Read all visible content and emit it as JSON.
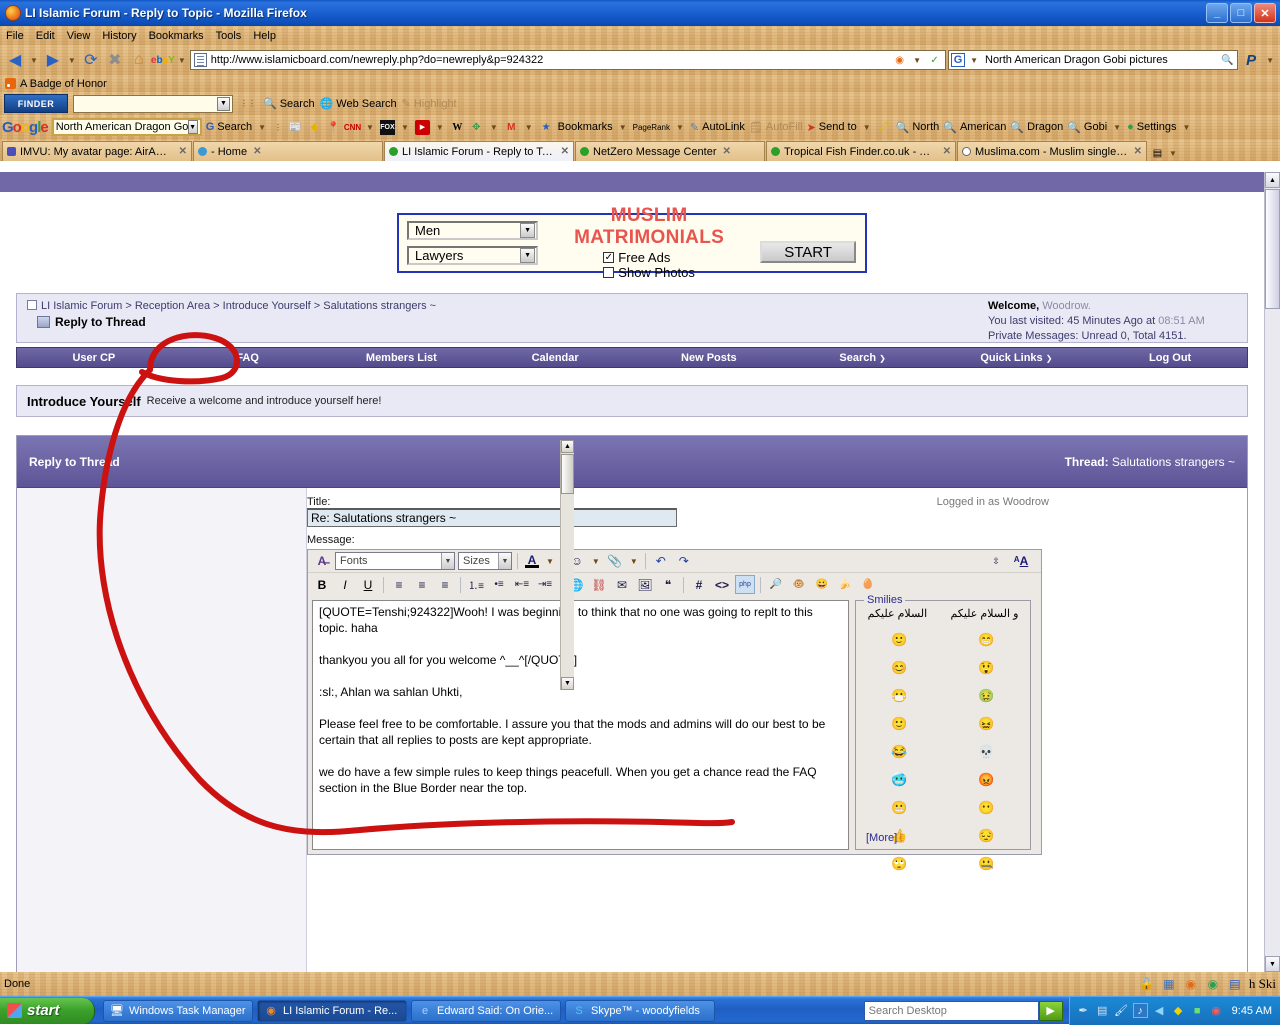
{
  "window": {
    "title": "LI Islamic Forum - Reply to Topic - Mozilla Firefox",
    "minimize": "_",
    "maximize": "□",
    "close": "✕"
  },
  "menubar": [
    "File",
    "Edit",
    "View",
    "History",
    "Bookmarks",
    "Tools",
    "Help"
  ],
  "navbar": {
    "back_icon": "back-arrow-icon",
    "forward_icon": "forward-arrow-icon",
    "reload_icon": "reload-icon",
    "stop_icon": "stop-icon",
    "home_icon": "home-icon",
    "ebay_icon": "ebay-icon",
    "url": "http://www.islamicboard.com/newreply.php?do=newreply&p=924322",
    "search_value": "North American Dragon Gobi pictures",
    "search_engine": "G",
    "paypal_icon": "paypal-icon"
  },
  "badge_bar": {
    "label": "A Badge of Honor"
  },
  "finder_bar": {
    "logo": "FINDER",
    "input_value": "",
    "buttons": [
      "Search",
      "Web Search",
      "Highlight"
    ]
  },
  "google_bar": {
    "logo_letters": [
      "G",
      "o",
      "o",
      "g",
      "l",
      "e"
    ],
    "query": "North American Dragon Gobi picture",
    "search_label": "Search",
    "items": [
      "Bookmarks",
      "PageRank",
      "AutoLink",
      "AutoFill",
      "Send to"
    ],
    "highlight_terms": [
      "North",
      "American",
      "Dragon",
      "Gobi"
    ],
    "settings_label": "Settings"
  },
  "tabs": [
    {
      "label": "IMVU: My avatar page: AirAnge...",
      "active": false,
      "icon": "imvu-icon"
    },
    {
      "label": "- Home",
      "active": false,
      "icon": "chat-icon"
    },
    {
      "label": "LI Islamic Forum - Reply to Topic",
      "active": true,
      "icon": "globe-icon"
    },
    {
      "label": "NetZero Message Center",
      "active": false,
      "icon": "globe-icon"
    },
    {
      "label": "Tropical Fish Finder.co.uk - The ...",
      "active": false,
      "icon": "globe-icon"
    },
    {
      "label": "Muslima.com - Muslim singles, d...",
      "active": false,
      "icon": "heart-icon"
    }
  ],
  "ad": {
    "gender_select": "Men",
    "profession_select": "Lawyers",
    "title": "MUSLIM MATRIMONIALS",
    "free_ads_label": "Free Ads",
    "free_ads_checked": true,
    "show_photos_label": "Show Photos",
    "show_photos_checked": false,
    "start_button": "START"
  },
  "breadcrumb": {
    "items": [
      "LI Islamic Forum",
      "Reception Area",
      "Introduce Yourself",
      "Salutations strangers ~"
    ],
    "separator": ">",
    "page_title": "Reply to Thread"
  },
  "welcome": {
    "greeting_label": "Welcome,",
    "username": "Woodrow.",
    "last_visited_label": "You last visited:",
    "last_visited_value": "45 Minutes Ago",
    "at_label": "at",
    "last_visited_time": "08:51 AM",
    "pm_line": "Private Messages: Unread 0, Total 4151."
  },
  "navstrip": [
    {
      "label": "User CP",
      "caret": false
    },
    {
      "label": "FAQ",
      "caret": false
    },
    {
      "label": "Members List",
      "caret": false
    },
    {
      "label": "Calendar",
      "caret": false
    },
    {
      "label": "New Posts",
      "caret": false
    },
    {
      "label": "Search",
      "caret": true
    },
    {
      "label": "Quick Links",
      "caret": true
    },
    {
      "label": "Log Out",
      "caret": false
    }
  ],
  "forum_desc": {
    "title": "Introduce Yourself",
    "description": "Receive a welcome and introduce yourself here!"
  },
  "panel": {
    "heading": "Reply to Thread",
    "thread_label": "Thread:",
    "thread_name": "Salutations strangers ~"
  },
  "form": {
    "title_label": "Title:",
    "title_value": "Re: Salutations strangers ~",
    "message_label": "Message:",
    "logged_in_label": "Logged in as",
    "logged_in_user": "Woodrow",
    "message_value": "[QUOTE=Tenshi;924322]Wooh! I was beginning to think that no one was going to replt to this topic. haha\n\nthankyou you all for you welcome ^__^[/QUOTE]\n\n:sl:, Ahlan wa sahlan Uhkti,\n\nPlease feel free to be comfortable. I assure you that the mods and admins will do our best to be certain that all replies to posts are kept appropriate.\n\nwe do have a few simple rules to keep things peacefull. When you get a chance read the FAQ section in the Blue Border near the top."
  },
  "editor": {
    "fonts_placeholder": "Fonts",
    "sizes_placeholder": "Sizes",
    "row1_icons": [
      "wysiwyg-toggle-icon",
      "font-color-icon",
      "smilie-icon",
      "attachment-icon",
      "undo-icon",
      "redo-icon",
      "resize-icon",
      "font-mode-icon"
    ],
    "row2_icons": [
      "bold-icon",
      "italic-icon",
      "underline-icon",
      "align-left-icon",
      "align-center-icon",
      "align-right-icon",
      "ordered-list-icon",
      "unordered-list-icon",
      "outdent-icon",
      "indent-icon",
      "link-icon",
      "unlink-icon",
      "email-icon",
      "image-icon",
      "quote-icon",
      "hash-icon",
      "code-icon",
      "php-icon"
    ],
    "bold_label": "B",
    "italic_label": "I",
    "underline_label": "U",
    "hash_label": "#",
    "code_label": "<>",
    "php_label": "php"
  },
  "smilies": {
    "legend": "Smilies",
    "arabic_left": "و السلام عليكم",
    "arabic_right": "السلام عليكم",
    "more_label": "[More]",
    "rows": [
      [
        "🙂",
        "😁"
      ],
      [
        "😊",
        "😲"
      ],
      [
        "😷",
        "🤢"
      ],
      [
        "🙂",
        "😖"
      ],
      [
        "😂",
        "💀"
      ],
      [
        "🥶",
        "😡"
      ],
      [
        "😬",
        "😶"
      ],
      [
        "👍",
        "😔"
      ],
      [
        "🙄",
        "🤐"
      ]
    ]
  },
  "statusbar": {
    "text": "Done",
    "tray_icons": [
      "lock-icon",
      "windows-icon",
      "firefox-icon",
      "avg-icon",
      "notes-icon"
    ],
    "skype_text": "h Ski"
  },
  "taskbar": {
    "start_label": "start",
    "buttons": [
      {
        "label": "Windows Task Manager",
        "icon": "taskmanager-icon",
        "active": false
      },
      {
        "label": "LI Islamic Forum - Re...",
        "icon": "firefox-icon",
        "active": true
      },
      {
        "label": "Edward Said: On Orie...",
        "icon": "ie-icon",
        "active": false
      },
      {
        "label": "Skype™ - woodyfields",
        "icon": "skype-icon",
        "active": false
      }
    ],
    "search_placeholder": "Search Desktop",
    "search_go": "▶",
    "tray": [
      "pen-icon",
      "monitor-icon",
      "brush-icon",
      "volume-icon",
      "media-icon",
      "shield-icon",
      "screen-icon",
      "antivirus-icon"
    ],
    "clock": "9:45 AM"
  },
  "colors": {
    "title_blue": "#1056c4",
    "nav_purple": "#534b8c",
    "ad_red": "#e8544e",
    "ink_red": "#cc1111"
  }
}
